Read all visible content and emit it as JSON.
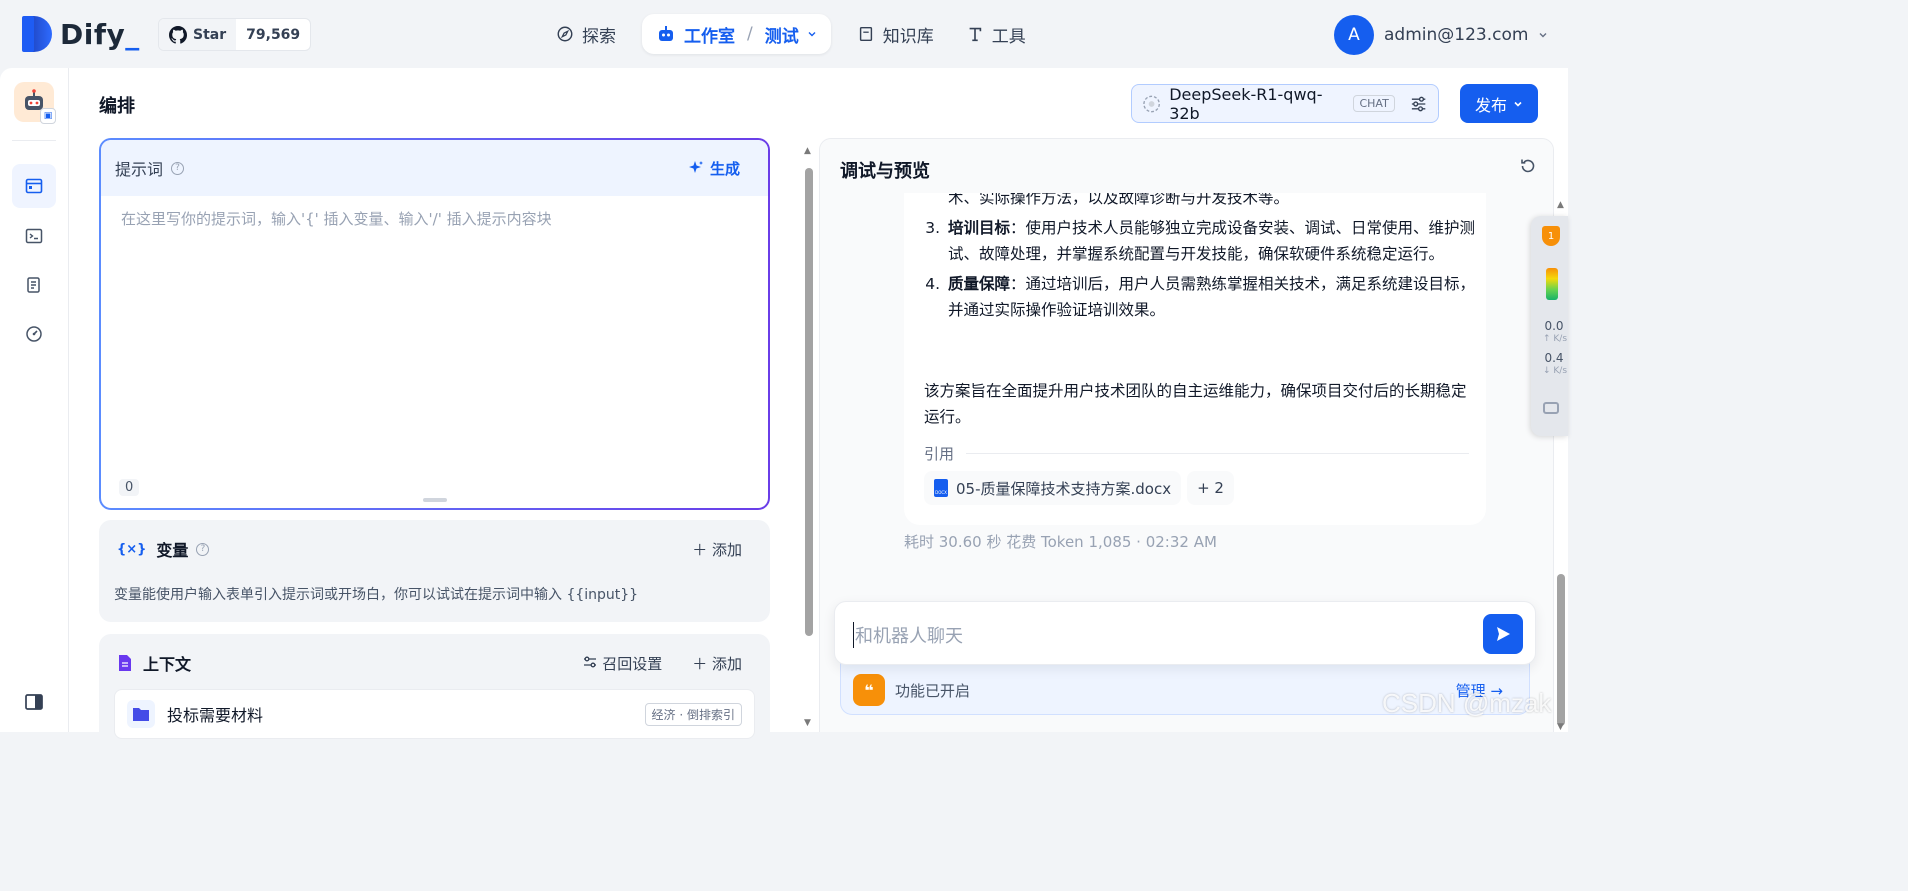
{
  "brand": {
    "name": "Dify",
    "suffix": "_"
  },
  "github": {
    "label": "Star",
    "count": "79,569"
  },
  "nav": {
    "explore": "探索",
    "studio": "工作室",
    "app_name": "测试",
    "knowledge": "知识库",
    "tools": "工具"
  },
  "user": {
    "initial": "A",
    "email": "admin@123.com"
  },
  "editor": {
    "title": "编排",
    "model": {
      "name": "DeepSeek-R1-qwq-32b",
      "mode": "CHAT"
    },
    "publish_label": "发布",
    "prompt": {
      "title": "提示词",
      "generate_label": "生成",
      "placeholder": "在这里写你的提示词，输入'{' 插入变量、输入'/' 插入提示内容块",
      "char_count": "0"
    },
    "variables": {
      "title": "变量",
      "icon_text": "{×}",
      "add_label": "添加",
      "description": "变量能使用户输入表单引入提示词或开场白，你可以试试在提示词中输入 {{input}}"
    },
    "context": {
      "title": "上下文",
      "recall_label": "召回设置",
      "add_label": "添加",
      "item_name": "投标需要材料",
      "item_tag": "经济 · 倒排索引"
    }
  },
  "debug": {
    "title": "调试与预览",
    "answer": {
      "item2_tail": "术、实际操作方法，以及故障诊断与开发技术等。",
      "items": [
        {
          "num": "3.",
          "title": "培训目标",
          "text": "：使用户技术人员能够独立完成设备安装、调试、日常使用、维护测试、故障处理，并掌握系统配置与开发技能，确保软硬件系统稳定运行。"
        },
        {
          "num": "4.",
          "title": "质量保障",
          "text": "：通过培训后，用户人员需熟练掌握相关技术，满足系统建设目标，并通过实际操作验证培训效果。"
        }
      ],
      "summary": "该方案旨在全面提升用户技术团队的自主运维能力，确保项目交付后的长期稳定运行。",
      "citation_label": "引用",
      "citation_file": "05-质量保障技术支持方案.docx",
      "citation_more": "+ 2"
    },
    "meta": "耗时 30.60 秒  花费 Token 1,085  ·  02:32 AM",
    "chat_placeholder": "和机器人聊天",
    "feature_status": "功能已开启",
    "manage_label": "管理"
  },
  "widget": {
    "up_value": "0.0",
    "down_value": "0.4",
    "unit": "K/s"
  },
  "watermark": "CSDN @mzak",
  "colors": {
    "primary": "#155eef",
    "accent_orange": "#f79009"
  }
}
